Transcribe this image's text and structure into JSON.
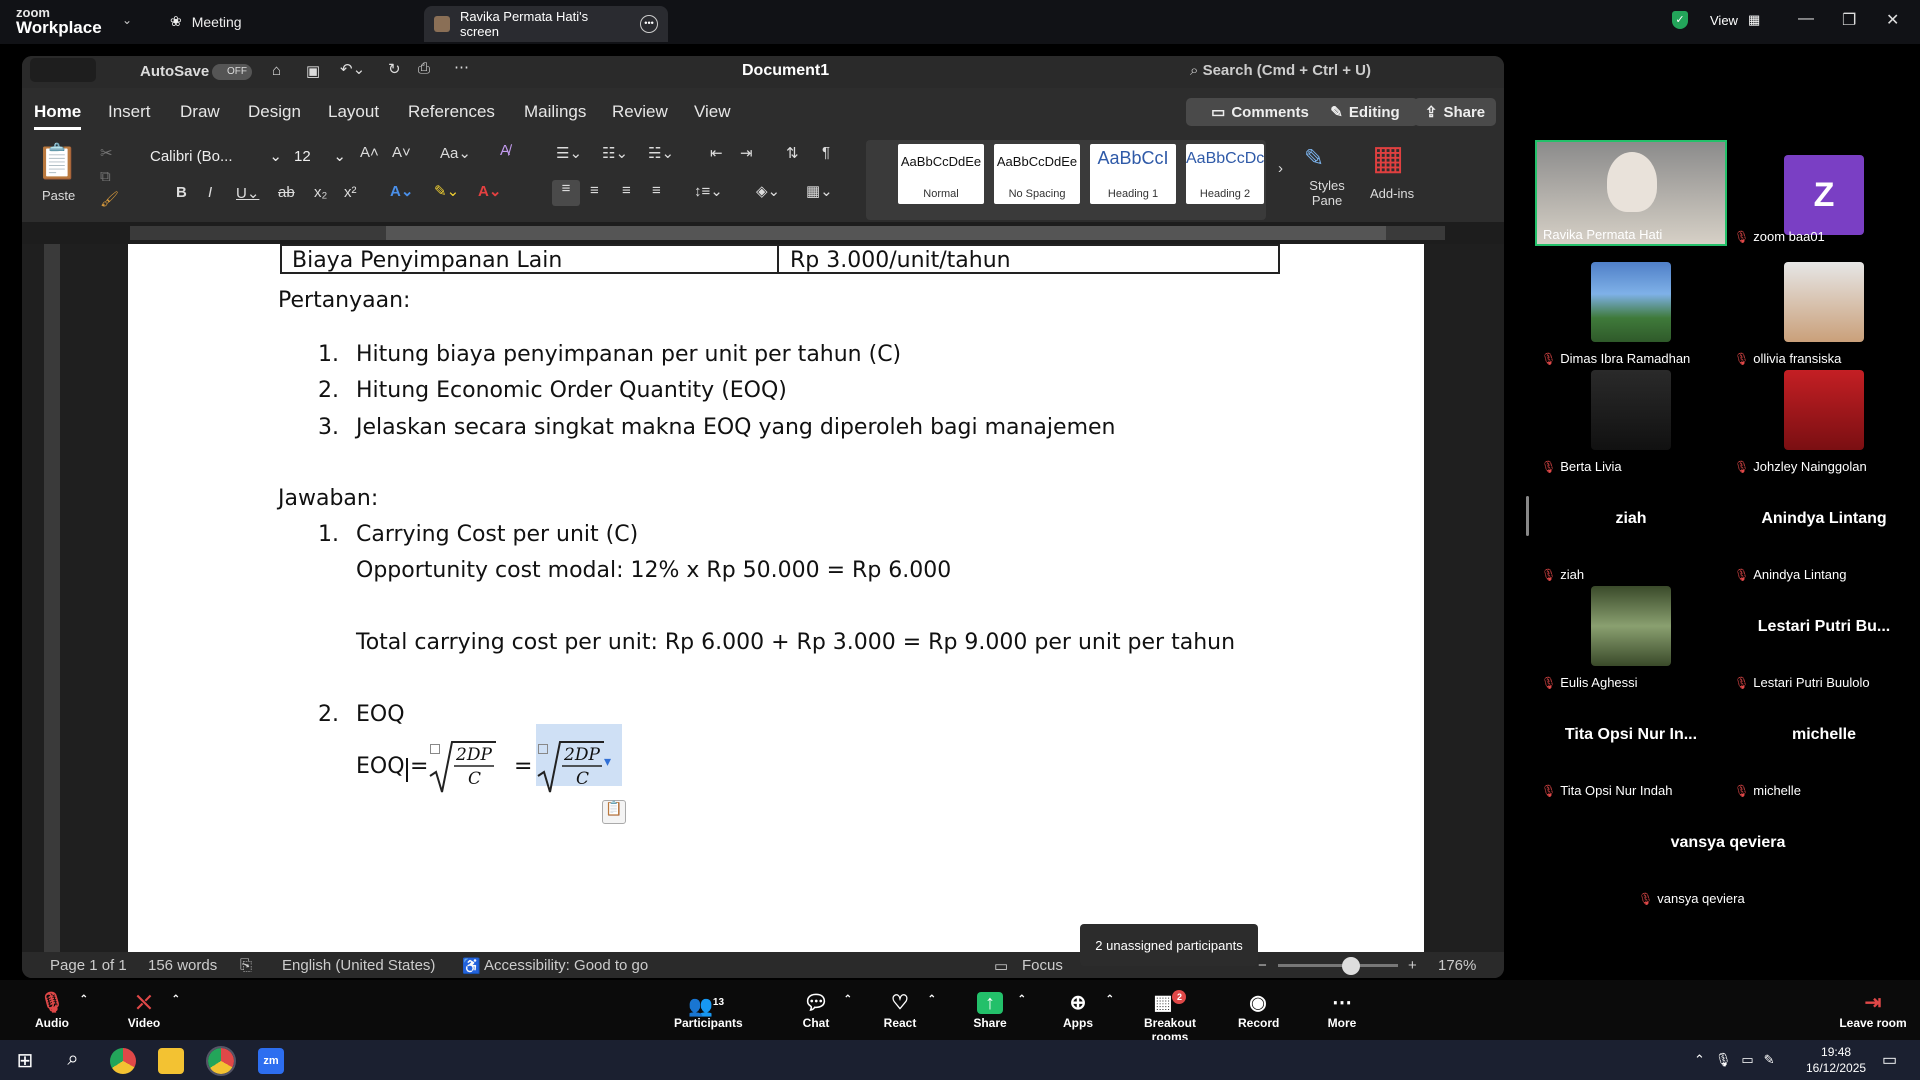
{
  "zoom": {
    "brand_top": "zoom",
    "brand_bottom": "Workplace",
    "meeting_label": "Meeting",
    "share_tab_label": "Ravika Permata Hati's screen",
    "view_label": "View"
  },
  "word": {
    "autosave_label": "AutoSave",
    "autosave_state": "OFF",
    "doc_title": "Document1",
    "search_placeholder": "Search (Cmd + Ctrl + U)",
    "tabs": [
      "Home",
      "Insert",
      "Draw",
      "Design",
      "Layout",
      "References",
      "Mailings",
      "Review",
      "View"
    ],
    "comments_label": "Comments",
    "editing_label": "Editing",
    "share_label": "Share",
    "paste_label": "Paste",
    "font_name": "Calibri (Bo...",
    "font_size": "12",
    "styles": [
      {
        "preview": "AaBbCcDdEe",
        "name": "Normal"
      },
      {
        "preview": "AaBbCcDdEe",
        "name": "No Spacing"
      },
      {
        "preview": "AaBbCcI",
        "name": "Heading 1"
      },
      {
        "preview": "AaBbCcDc",
        "name": "Heading 2"
      }
    ],
    "styles_pane_label": "Styles Pane",
    "addins_label": "Add-ins",
    "status": {
      "page": "Page 1 of 1",
      "words": "156 words",
      "language": "English (United States)",
      "accessibility": "Accessibility: Good to go",
      "focus": "Focus",
      "zoom": "176%"
    }
  },
  "document": {
    "table_row": [
      "Biaya Penyimpanan Lain",
      "Rp 3.000/unit/tahun"
    ],
    "pertanyaan_heading": "Pertanyaan:",
    "questions": [
      {
        "num": "1.",
        "text": "Hitung biaya penyimpanan per unit per tahun (C)"
      },
      {
        "num": "2.",
        "text": "Hitung Economic Order Quantity (EOQ)"
      },
      {
        "num": "3.",
        "text": "Jelaskan secara singkat makna EOQ yang diperoleh bagi manajemen"
      }
    ],
    "jawaban_heading": "Jawaban:",
    "answer1_num": "1.",
    "answer1_title": "Carrying Cost per unit (C)",
    "answer1_line1": "Opportunity cost modal: 12% x Rp 50.000 = Rp 6.000",
    "answer1_line2": "Total carrying cost per unit: Rp 6.000 + Rp 3.000 = Rp 9.000 per unit per tahun",
    "answer2_num": "2.",
    "answer2_title": "EOQ",
    "eoq_label": "EOQ",
    "eoq_numerator": "2DP",
    "eoq_denominator": "C"
  },
  "participants": [
    {
      "name": "Ravika Permata Hati",
      "active": true
    },
    {
      "name": "zoom baa01",
      "avatar_letter": "Z",
      "avatar_color": "#7a3fc4"
    },
    {
      "name": "Dimas Ibra Ramadhan"
    },
    {
      "name": "ollivia fransiska"
    },
    {
      "name": "Berta Livia"
    },
    {
      "name": "Johzley Nainggolan"
    },
    {
      "name": "ziah",
      "big": "ziah"
    },
    {
      "name": "Anindya Lintang",
      "big": "Anindya Lintang"
    },
    {
      "name": "Eulis Aghessi"
    },
    {
      "name": "Lestari Putri Buulolo",
      "big": "Lestari Putri Bu..."
    },
    {
      "name": "Tita Opsi Nur Indah",
      "big": "Tita Opsi Nur In..."
    },
    {
      "name": "michelle",
      "big": "michelle"
    },
    {
      "name": "vansya qeviera",
      "big": "vansya qeviera"
    }
  ],
  "toolbar": {
    "audio": "Audio",
    "video": "Video",
    "participants": "Participants",
    "participants_count": "13",
    "chat": "Chat",
    "react": "React",
    "share": "Share",
    "apps": "Apps",
    "breakout": "Breakout rooms",
    "breakout_badge": "2",
    "record": "Record",
    "more": "More",
    "leave": "Leave room",
    "tooltip": "2 unassigned participants"
  },
  "taskbar": {
    "time": "19:48",
    "date": "16/12/2025"
  }
}
